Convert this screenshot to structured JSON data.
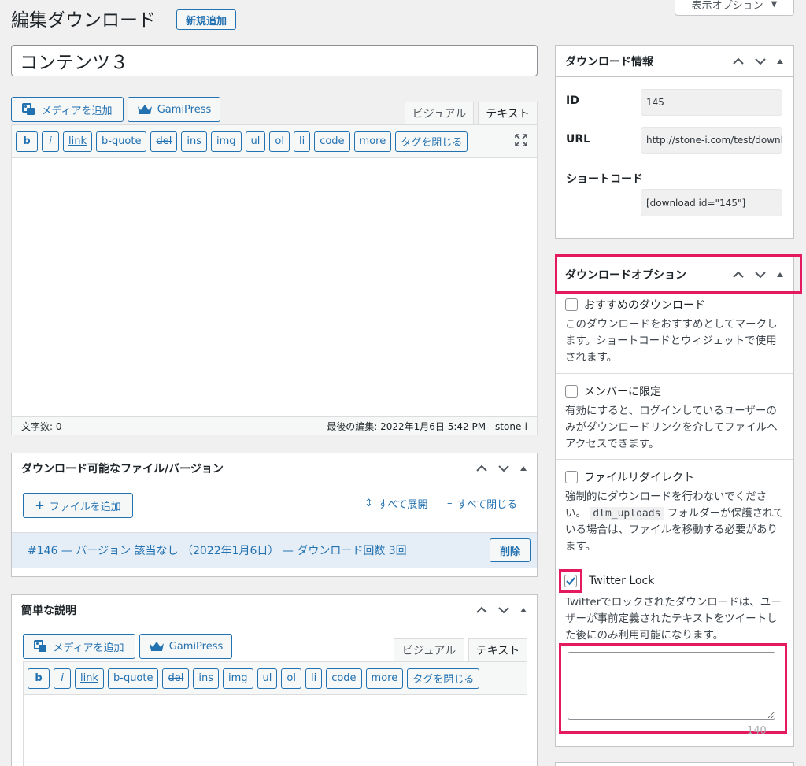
{
  "page": {
    "title": "編集ダウンロード",
    "add_new": "新規追加",
    "screen_options": "表示オプション"
  },
  "post_title": "コンテンツ３",
  "editor": {
    "add_media": "メディアを追加",
    "gamipress": "GamiPress",
    "tab_visual": "ビジュアル",
    "tab_text": "テキスト",
    "quicktags": [
      "b",
      "i",
      "link",
      "b-quote",
      "del",
      "ins",
      "img",
      "ul",
      "ol",
      "li",
      "code",
      "more",
      "タグを閉じる"
    ],
    "word_count": "文字数: 0",
    "last_edited": "最後の編集: 2022年1月6日 5:42 PM - stone-i"
  },
  "files_box": {
    "title": "ダウンロード可能なファイル/バージョン",
    "add_file": "ファイルを追加",
    "expand_all": "すべて展開",
    "collapse_all": "すべて閉じる",
    "version_row": "#146 — バージョン 該当なし （2022年1月6日） — ダウンロード回数 3回",
    "delete": "削除"
  },
  "short_desc_box": {
    "title": "簡単な説明",
    "add_media": "メディアを追加",
    "gamipress": "GamiPress",
    "tab_visual": "ビジュアル",
    "tab_text": "テキスト",
    "quicktags": [
      "b",
      "i",
      "link",
      "b-quote",
      "del",
      "ins",
      "img",
      "ul",
      "ol",
      "li",
      "code",
      "more",
      "タグを閉じる"
    ]
  },
  "info_box": {
    "title": "ダウンロード情報",
    "id_label": "ID",
    "id_value": "145",
    "url_label": "URL",
    "url_value": "http://stone-i.com/test/download/",
    "shortcode_label": "ショートコード",
    "shortcode_value": "[download id=\"145\"]"
  },
  "options_box": {
    "title": "ダウンロードオプション",
    "featured_label": "おすすめのダウンロード",
    "featured_desc": "このダウンロードをおすすめとしてマークします。ショートコードとウィジェットで使用されます。",
    "members_label": "メンバーに限定",
    "members_desc": "有効にすると、ログインしているユーザーのみがダウンロードリンクを介してファイルへアクセスできます。",
    "redirect_label": "ファイルリダイレクト",
    "redirect_desc_1": "強制的にダウンロードを行わないでください。",
    "redirect_code": "dlm_uploads",
    "redirect_desc_2": "フォルダーが保護されている場合は、ファイルを移動する必要があります。",
    "twitter_label": "Twitter Lock",
    "twitter_desc": "Twitterでロックされたダウンロードは、ユーザーが事前定義されたテキストをツイートした後にのみ利用可能になります。",
    "char_count": "140"
  },
  "colors": {
    "accent": "#2271b1",
    "highlight": "#e5195e"
  }
}
